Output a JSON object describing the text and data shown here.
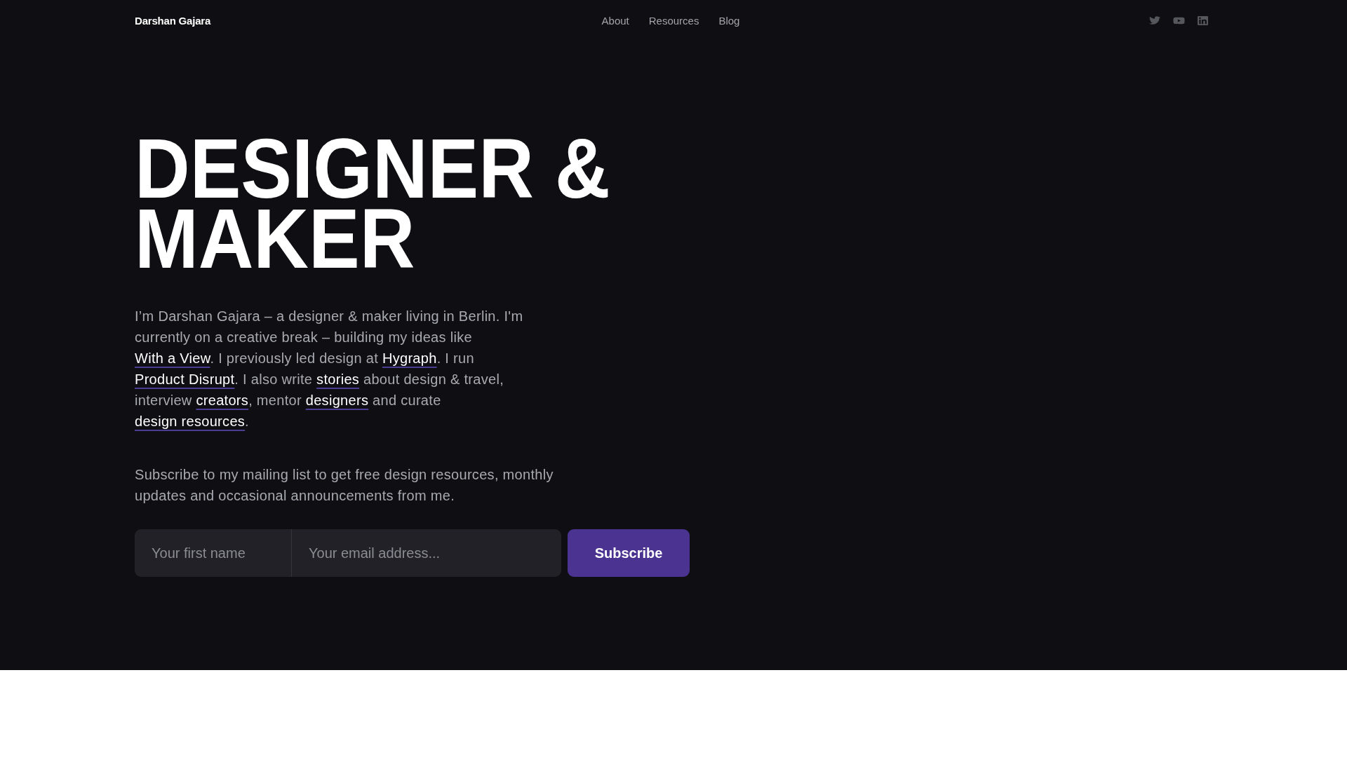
{
  "header": {
    "logo": "Darshan Gajara",
    "nav": [
      "About",
      "Resources",
      "Blog"
    ],
    "social": [
      {
        "kind": "twitter"
      },
      {
        "kind": "youtube"
      },
      {
        "kind": "linkedin"
      }
    ]
  },
  "hero": {
    "headline": "DESIGNER & MAKER",
    "bio": [
      {
        "kind": "text",
        "text": "I’m Darshan Gajara – a designer & maker living in Berlin. I'm currently on a creative break – building my ideas like "
      },
      {
        "kind": "link",
        "text": "With a View"
      },
      {
        "kind": "text",
        "text": ". I previously led design at "
      },
      {
        "kind": "link",
        "text": "Hygraph"
      },
      {
        "kind": "text",
        "text": ". I run "
      },
      {
        "kind": "link",
        "text": "Product Disrupt"
      },
      {
        "kind": "text",
        "text": ". I also write "
      },
      {
        "kind": "link",
        "text": "stories"
      },
      {
        "kind": "text",
        "text": " about design & travel, interview "
      },
      {
        "kind": "link",
        "text": "creators"
      },
      {
        "kind": "text",
        "text": ", mentor "
      },
      {
        "kind": "link",
        "text": "designers"
      },
      {
        "kind": "text",
        "text": " and curate "
      },
      {
        "kind": "link",
        "text": "design resources"
      },
      {
        "kind": "text",
        "text": "."
      }
    ]
  },
  "subscribe": {
    "text": "Subscribe to my mailing list to get free design resources, monthly updates and occasional announcements from me.",
    "first_name": {
      "placeholder": "Your first name"
    },
    "email": {
      "placeholder": "Your email address..."
    },
    "button": "Subscribe"
  }
}
